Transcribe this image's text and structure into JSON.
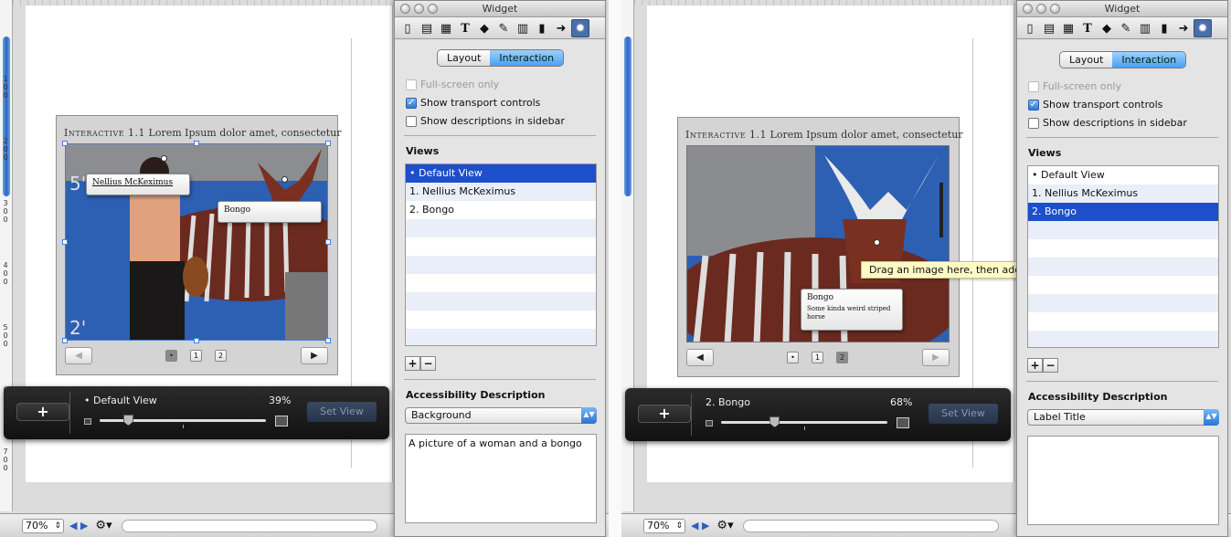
{
  "status": {
    "zoom": "70%"
  },
  "widget": {
    "title_prefix": "Interactive 1.1",
    "title_rest": "Lorem Ipsum dolor amet, consectetur",
    "pages": [
      "1",
      "2"
    ],
    "prev_icon": "left-triangle-icon",
    "next_icon": "right-triangle-icon"
  },
  "left": {
    "callouts": [
      {
        "title": "Nellius McKeximus",
        "desc": ""
      },
      {
        "title": "Bongo",
        "desc": ""
      }
    ],
    "hud": {
      "add_label": "+",
      "view_name": "• Default View",
      "percent": "39%",
      "set_view_label": "Set View",
      "zoom_fraction": 0.17
    },
    "accessibility_popup": "Background",
    "accessibility_text": "A picture of a woman and a bongo",
    "views_selected": 0
  },
  "right": {
    "callouts": [
      {
        "title": "Bongo",
        "desc": "Some kinda weird striped horse"
      }
    ],
    "tooltip": "Drag an image here, then add views.",
    "hud": {
      "add_label": "+",
      "view_name": "2. Bongo",
      "percent": "68%",
      "set_view_label": "Set View",
      "zoom_fraction": 0.32
    },
    "accessibility_popup": "Label Title",
    "accessibility_text": "",
    "views_selected": 2
  },
  "inspector": {
    "title": "Widget",
    "tabs": [
      "Layout",
      "Interaction"
    ],
    "checkboxes": [
      {
        "label": "Full-screen only",
        "checked": false,
        "disabled": true
      },
      {
        "label": "Show transport controls",
        "checked": true,
        "disabled": false
      },
      {
        "label": "Show descriptions in sidebar",
        "checked": false,
        "disabled": false
      }
    ],
    "views_heading": "Views",
    "views": [
      "• Default View",
      "1. Nellius McKeximus",
      "2. Bongo"
    ],
    "add_label": "+",
    "remove_label": "−",
    "accessibility_heading": "Accessibility Description",
    "toolbar_icons": [
      "document-icon",
      "layout-icon",
      "text-box-icon",
      "text-icon",
      "shapes-icon",
      "ruler-icon",
      "table-icon",
      "chart-icon",
      "link-icon",
      "widget-icon"
    ]
  },
  "colors": {
    "selection": "#1c4fc9",
    "accent": "#4ba0f0",
    "hud": "#1a1a1a",
    "tooltip": "#fffbc6"
  }
}
